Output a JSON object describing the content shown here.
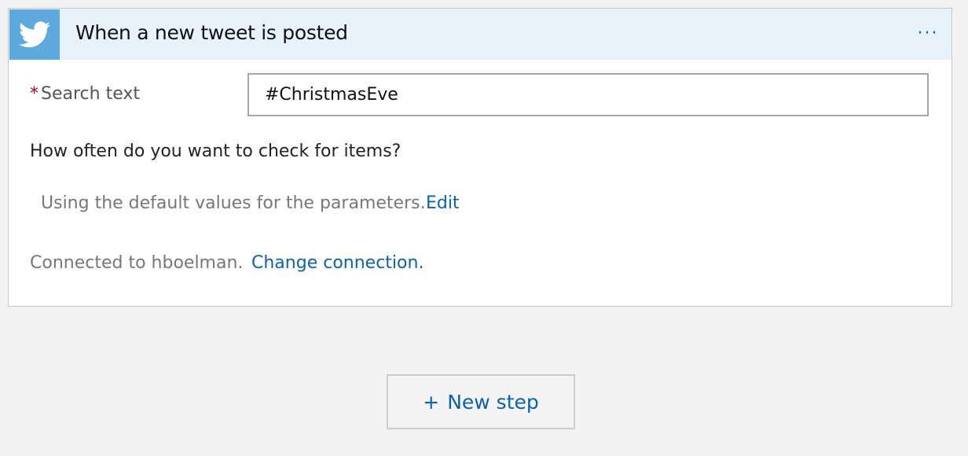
{
  "trigger": {
    "icon": "twitter-bird-icon",
    "title": "When a new tweet is posted",
    "more_label": "···",
    "header_color": "#e8f2fb",
    "brand_color": "#5ea9dd"
  },
  "search": {
    "required_mark": "*",
    "label": "Search text",
    "value": "#ChristmasEve"
  },
  "frequency": {
    "heading": "How often do you want to check for items?",
    "defaults_text": "Using the default values for the parameters.",
    "edit_label": "Edit"
  },
  "connection": {
    "status_text": "Connected to hboelman.",
    "change_label": "Change connection."
  },
  "new_step": {
    "icon": "plus-icon",
    "plus_glyph": "+",
    "label": "New step"
  },
  "colors": {
    "link": "#0a62b0",
    "required": "#c4001a",
    "background": "#f2f2f2"
  }
}
